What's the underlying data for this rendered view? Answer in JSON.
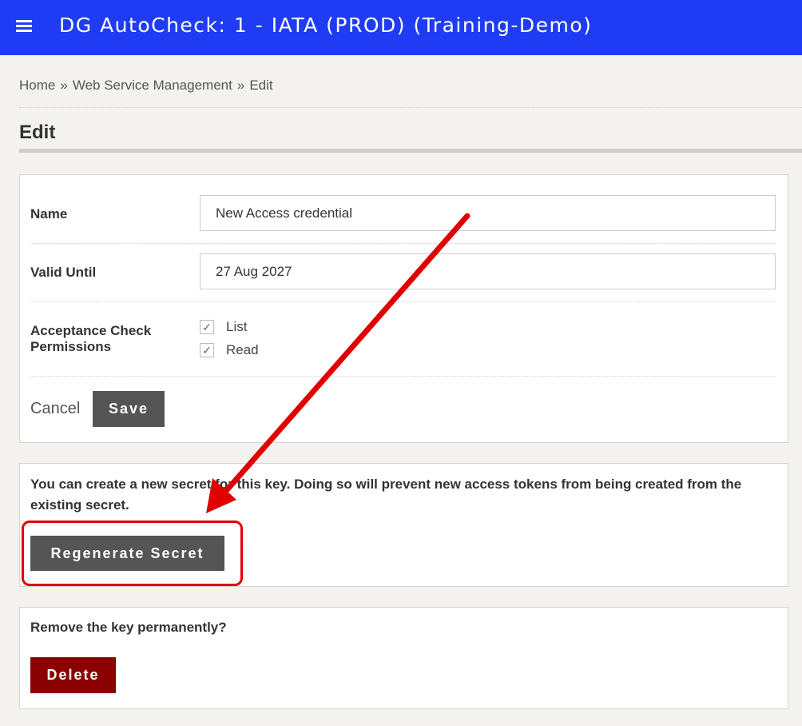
{
  "header": {
    "app_title": "DG AutoCheck: 1 - IATA (PROD) (Training-Demo)",
    "menu_icon": "hamburger-menu-icon"
  },
  "breadcrumb": {
    "items": [
      "Home",
      "Web Service Management",
      "Edit"
    ],
    "separator": "»"
  },
  "page": {
    "title": "Edit"
  },
  "form": {
    "name_label": "Name",
    "name_value": "New Access credential",
    "valid_until_label": "Valid Until",
    "valid_until_value": "27 Aug 2027",
    "permissions_label_line1": "Acceptance Check",
    "permissions_label_line2": "Permissions",
    "permissions": [
      {
        "label": "List",
        "checked": true
      },
      {
        "label": "Read",
        "checked": true
      }
    ],
    "check_mark": "✓",
    "cancel_label": "Cancel",
    "save_label": "Save"
  },
  "secret": {
    "text_line1": "You can create a new secret for this key. Doing so will prevent new access tokens from being created from the",
    "text_line2": "existing secret.",
    "regenerate_label": "Regenerate Secret"
  },
  "remove": {
    "text": "Remove the key permanently?",
    "delete_label": "Delete"
  },
  "colors": {
    "header_bg": "#1f3cf4",
    "button_dark": "#555555",
    "button_delete": "#8b0000",
    "annotation_red": "#e00000"
  }
}
